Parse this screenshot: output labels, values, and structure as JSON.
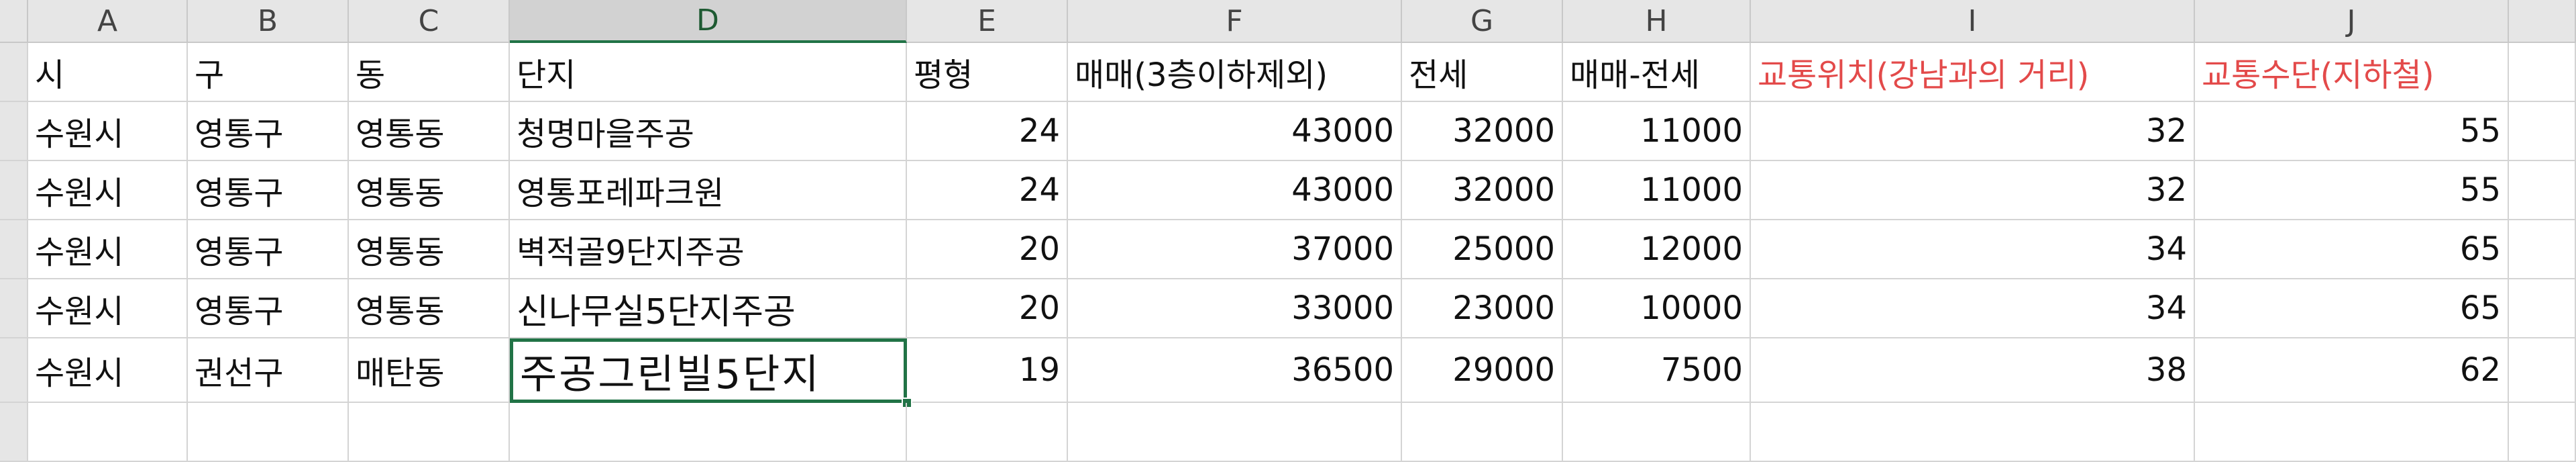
{
  "columns": [
    "A",
    "B",
    "C",
    "D",
    "E",
    "F",
    "G",
    "H",
    "I",
    "J"
  ],
  "header_row": [
    "시",
    "구",
    "동",
    "단지",
    "평형",
    "매매(3층이하제외)",
    "전세",
    "매매-전세",
    "교통위치(강남과의 거리)",
    "교통수단(지하철)"
  ],
  "rows": [
    [
      "수원시",
      "영통구",
      "영통동",
      "청명마을주공",
      "24",
      "43000",
      "32000",
      "11000",
      "32",
      "55"
    ],
    [
      "수원시",
      "영통구",
      "영통동",
      "영통포레파크원",
      "24",
      "43000",
      "32000",
      "11000",
      "32",
      "55"
    ],
    [
      "수원시",
      "영통구",
      "영통동",
      "벽적골9단지주공",
      "20",
      "37000",
      "25000",
      "12000",
      "34",
      "65"
    ],
    [
      "수원시",
      "영통구",
      "영통동",
      "신나무실5단지주공",
      "20",
      "33000",
      "23000",
      "10000",
      "34",
      "65"
    ],
    [
      "수원시",
      "권선구",
      "매탄동",
      "주공그린빌5단지",
      "19",
      "36500",
      "29000",
      "7500",
      "38",
      "62"
    ]
  ],
  "selected_cell": "D6",
  "colors": {
    "header_highlight": "#e34a4a",
    "selection": "#217346"
  }
}
